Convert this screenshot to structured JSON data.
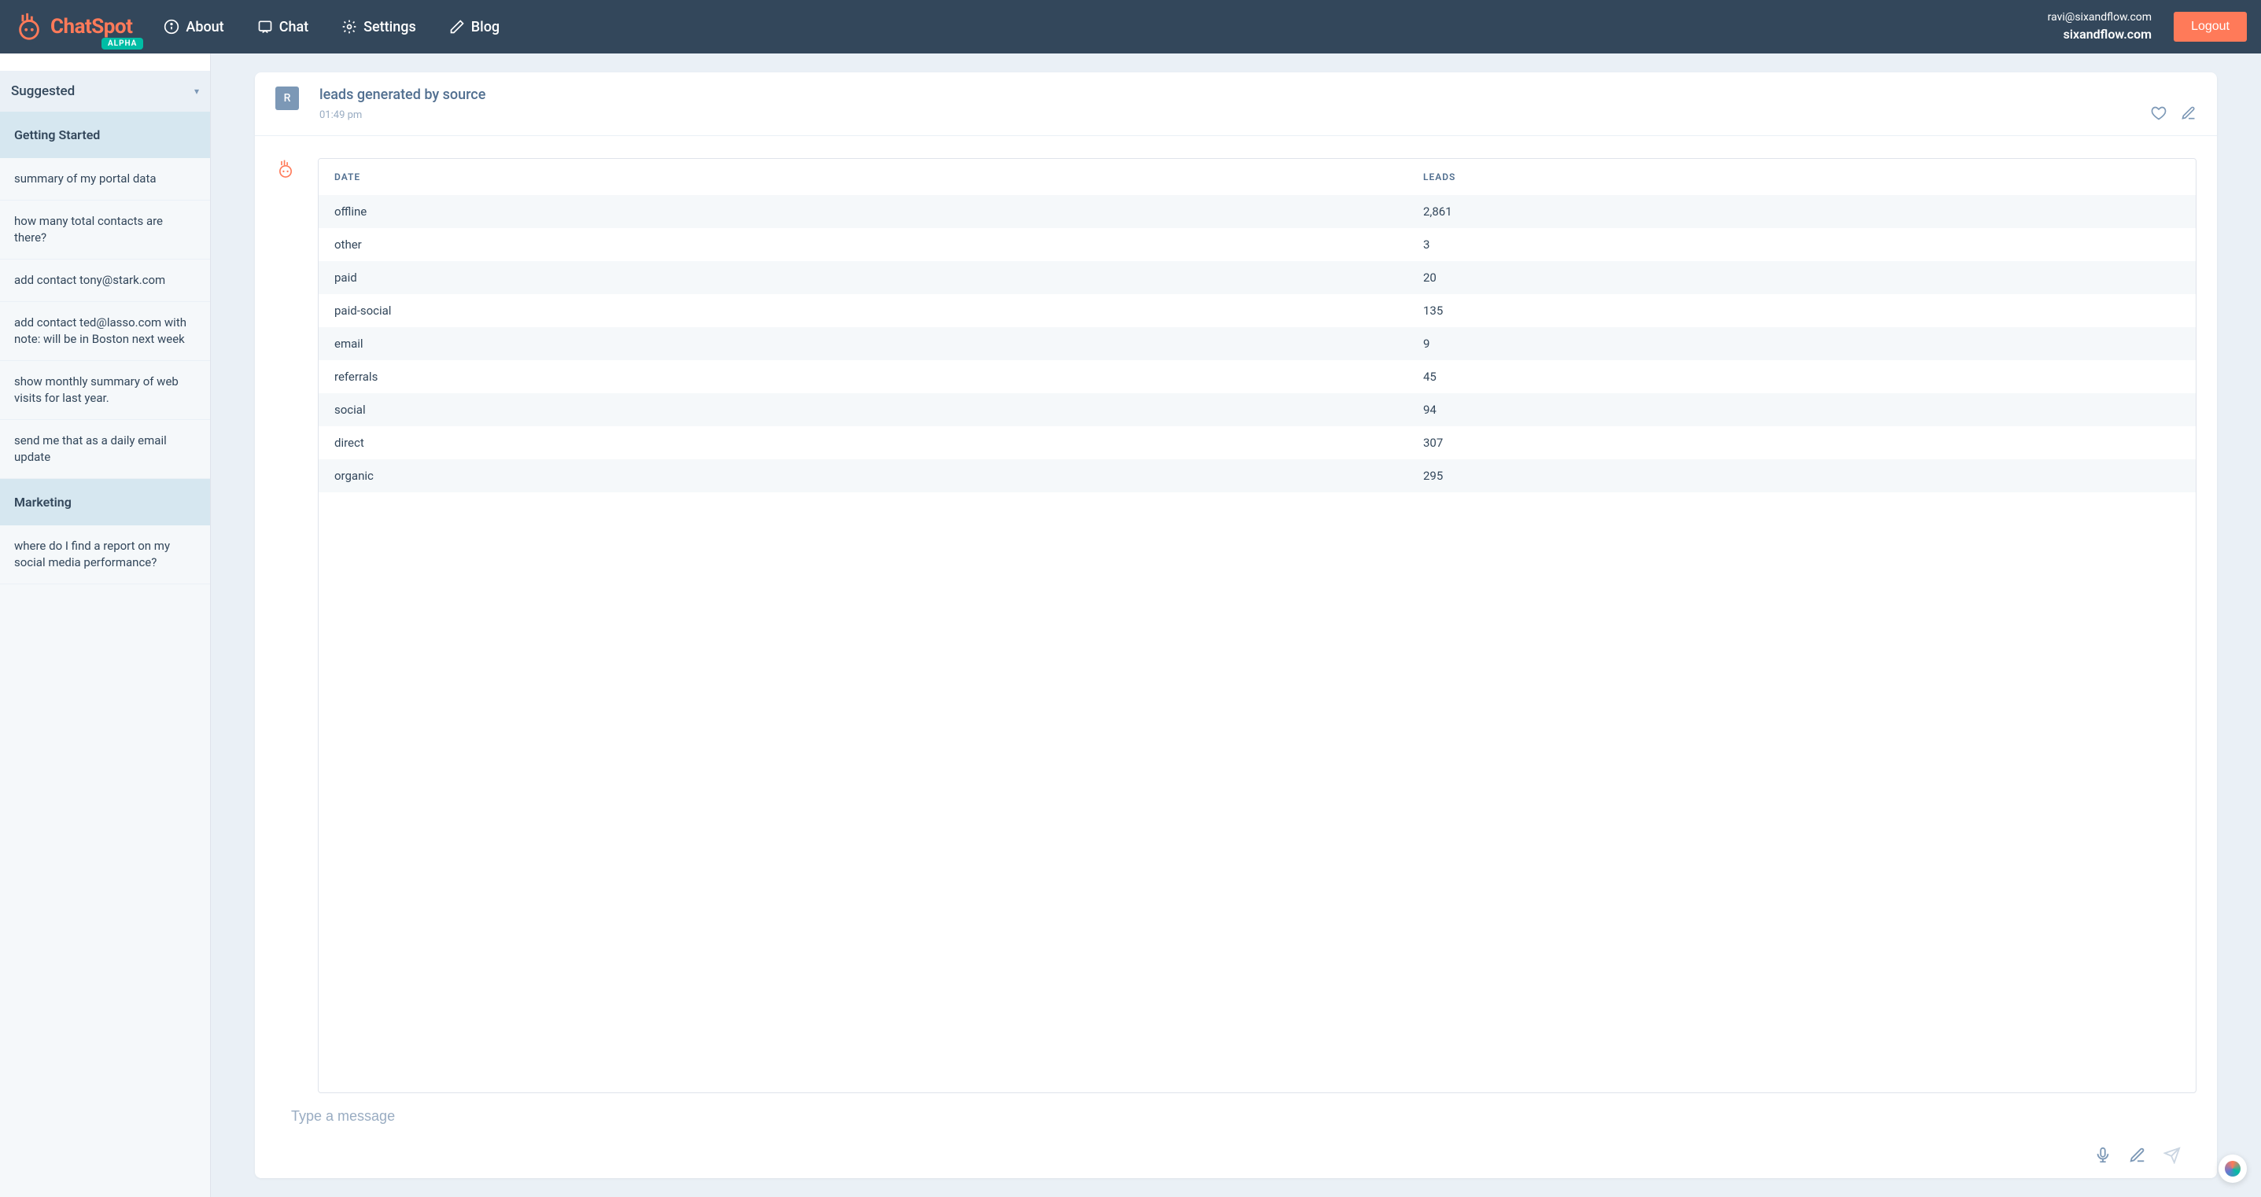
{
  "header": {
    "brand": "ChatSpot",
    "badge": "ALPHA",
    "nav": [
      {
        "label": "About"
      },
      {
        "label": "Chat"
      },
      {
        "label": "Settings"
      },
      {
        "label": "Blog"
      }
    ],
    "user_email": "ravi@sixandflow.com",
    "user_org": "sixandflow.com",
    "logout": "Logout"
  },
  "sidebar": {
    "suggested_label": "Suggested",
    "sections": [
      {
        "title": "Getting Started",
        "items": [
          "summary of my portal data",
          "how many total contacts are there?",
          "add contact tony@stark.com",
          "add contact ted@lasso.com with note: will be in Boston next week",
          "show monthly summary of web visits for last year.",
          "send me that as a daily email update"
        ]
      },
      {
        "title": "Marketing",
        "items": [
          "where do I find a report on my social media performance?"
        ]
      }
    ]
  },
  "chat": {
    "user_initial": "R",
    "prompt": "leads generated by source",
    "time": "01:49 pm",
    "table": {
      "headers": [
        "DATE",
        "LEADS"
      ],
      "rows": [
        [
          "offline",
          "2,861"
        ],
        [
          "other",
          "3"
        ],
        [
          "paid",
          "20"
        ],
        [
          "paid-social",
          "135"
        ],
        [
          "email",
          "9"
        ],
        [
          "referrals",
          "45"
        ],
        [
          "social",
          "94"
        ],
        [
          "direct",
          "307"
        ],
        [
          "organic",
          "295"
        ]
      ]
    },
    "input_placeholder": "Type a message"
  }
}
